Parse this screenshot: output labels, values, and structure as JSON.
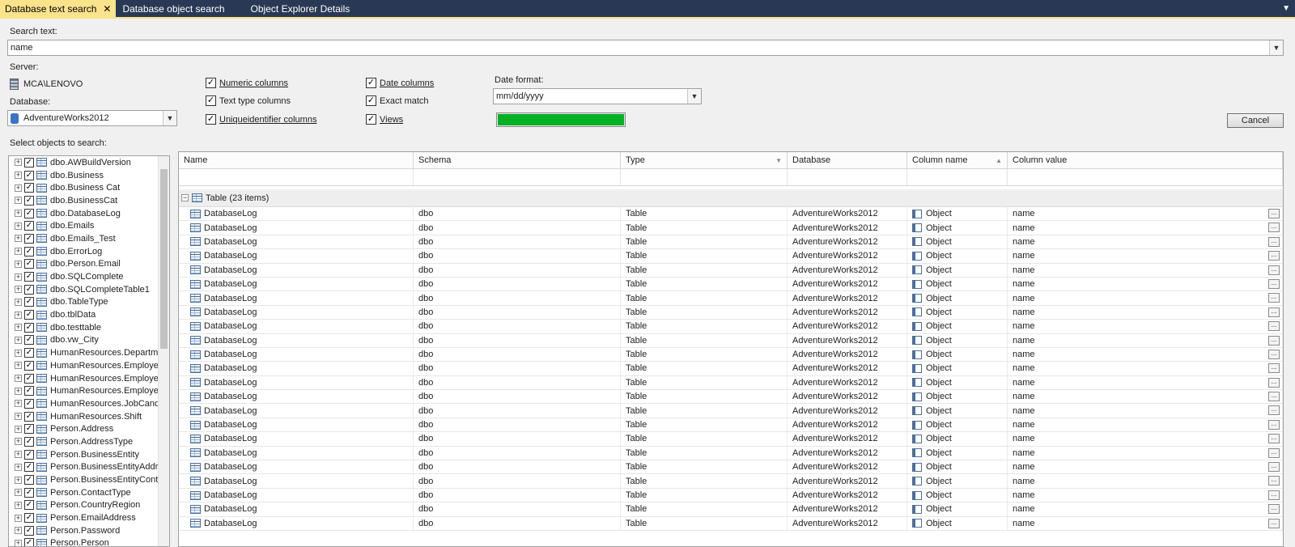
{
  "tabs": [
    {
      "label": "Database text search",
      "active": true
    },
    {
      "label": "Database object search",
      "active": false
    },
    {
      "label": "Object Explorer Details",
      "active": false
    }
  ],
  "search": {
    "label": "Search text:",
    "value": "name"
  },
  "server": {
    "label": "Server:",
    "value": "MCA\\LENOVO"
  },
  "database": {
    "label": "Database:",
    "value": "AdventureWorks2012"
  },
  "options": {
    "numeric": "Numeric columns",
    "text_type": "Text type columns",
    "uniqueidentifier": "Uniqueidentifier columns",
    "date": "Date columns",
    "exact": "Exact match",
    "views": "Views"
  },
  "date_format": {
    "label": "Date format:",
    "value": "mm/dd/yyyy"
  },
  "progress": {
    "value": 1.0,
    "color": "#06b025"
  },
  "cancel_label": "Cancel",
  "objects_label": "Select objects to search:",
  "objects": [
    "dbo.AWBuildVersion",
    "dbo.Business",
    "dbo.Business Cat",
    "dbo.BusinessCat",
    "dbo.DatabaseLog",
    "dbo.Emails",
    "dbo.Emails_Test",
    "dbo.ErrorLog",
    "dbo.Person.Email",
    "dbo.SQLComplete",
    "dbo.SQLCompleteTable1",
    "dbo.TableType",
    "dbo.tblData",
    "dbo.testtable",
    "dbo.vw_City",
    "HumanResources.Departme",
    "HumanResources.Employee",
    "HumanResources.Employee",
    "HumanResources.Employee",
    "HumanResources.JobCandi",
    "HumanResources.Shift",
    "Person.Address",
    "Person.AddressType",
    "Person.BusinessEntity",
    "Person.BusinessEntityAddre",
    "Person.BusinessEntityConta",
    "Person.ContactType",
    "Person.CountryRegion",
    "Person.EmailAddress",
    "Person.Password",
    "Person.Person"
  ],
  "grid": {
    "columns": [
      "Name",
      "Schema",
      "Type",
      "Database",
      "Column name",
      "Column value"
    ],
    "group_label": "Table (23 items)",
    "rows": [
      [
        "DatabaseLog",
        "dbo",
        "Table",
        "AdventureWorks2012",
        "Object",
        "name"
      ],
      [
        "DatabaseLog",
        "dbo",
        "Table",
        "AdventureWorks2012",
        "Object",
        "name"
      ],
      [
        "DatabaseLog",
        "dbo",
        "Table",
        "AdventureWorks2012",
        "Object",
        "name"
      ],
      [
        "DatabaseLog",
        "dbo",
        "Table",
        "AdventureWorks2012",
        "Object",
        "name"
      ],
      [
        "DatabaseLog",
        "dbo",
        "Table",
        "AdventureWorks2012",
        "Object",
        "name"
      ],
      [
        "DatabaseLog",
        "dbo",
        "Table",
        "AdventureWorks2012",
        "Object",
        "name"
      ],
      [
        "DatabaseLog",
        "dbo",
        "Table",
        "AdventureWorks2012",
        "Object",
        "name"
      ],
      [
        "DatabaseLog",
        "dbo",
        "Table",
        "AdventureWorks2012",
        "Object",
        "name"
      ],
      [
        "DatabaseLog",
        "dbo",
        "Table",
        "AdventureWorks2012",
        "Object",
        "name"
      ],
      [
        "DatabaseLog",
        "dbo",
        "Table",
        "AdventureWorks2012",
        "Object",
        "name"
      ],
      [
        "DatabaseLog",
        "dbo",
        "Table",
        "AdventureWorks2012",
        "Object",
        "name"
      ],
      [
        "DatabaseLog",
        "dbo",
        "Table",
        "AdventureWorks2012",
        "Object",
        "name"
      ],
      [
        "DatabaseLog",
        "dbo",
        "Table",
        "AdventureWorks2012",
        "Object",
        "name"
      ],
      [
        "DatabaseLog",
        "dbo",
        "Table",
        "AdventureWorks2012",
        "Object",
        "name"
      ],
      [
        "DatabaseLog",
        "dbo",
        "Table",
        "AdventureWorks2012",
        "Object",
        "name"
      ],
      [
        "DatabaseLog",
        "dbo",
        "Table",
        "AdventureWorks2012",
        "Object",
        "name"
      ],
      [
        "DatabaseLog",
        "dbo",
        "Table",
        "AdventureWorks2012",
        "Object",
        "name"
      ],
      [
        "DatabaseLog",
        "dbo",
        "Table",
        "AdventureWorks2012",
        "Object",
        "name"
      ],
      [
        "DatabaseLog",
        "dbo",
        "Table",
        "AdventureWorks2012",
        "Object",
        "name"
      ],
      [
        "DatabaseLog",
        "dbo",
        "Table",
        "AdventureWorks2012",
        "Object",
        "name"
      ],
      [
        "DatabaseLog",
        "dbo",
        "Table",
        "AdventureWorks2012",
        "Object",
        "name"
      ],
      [
        "DatabaseLog",
        "dbo",
        "Table",
        "AdventureWorks2012",
        "Object",
        "name"
      ],
      [
        "DatabaseLog",
        "dbo",
        "Table",
        "AdventureWorks2012",
        "Object",
        "name"
      ]
    ]
  }
}
